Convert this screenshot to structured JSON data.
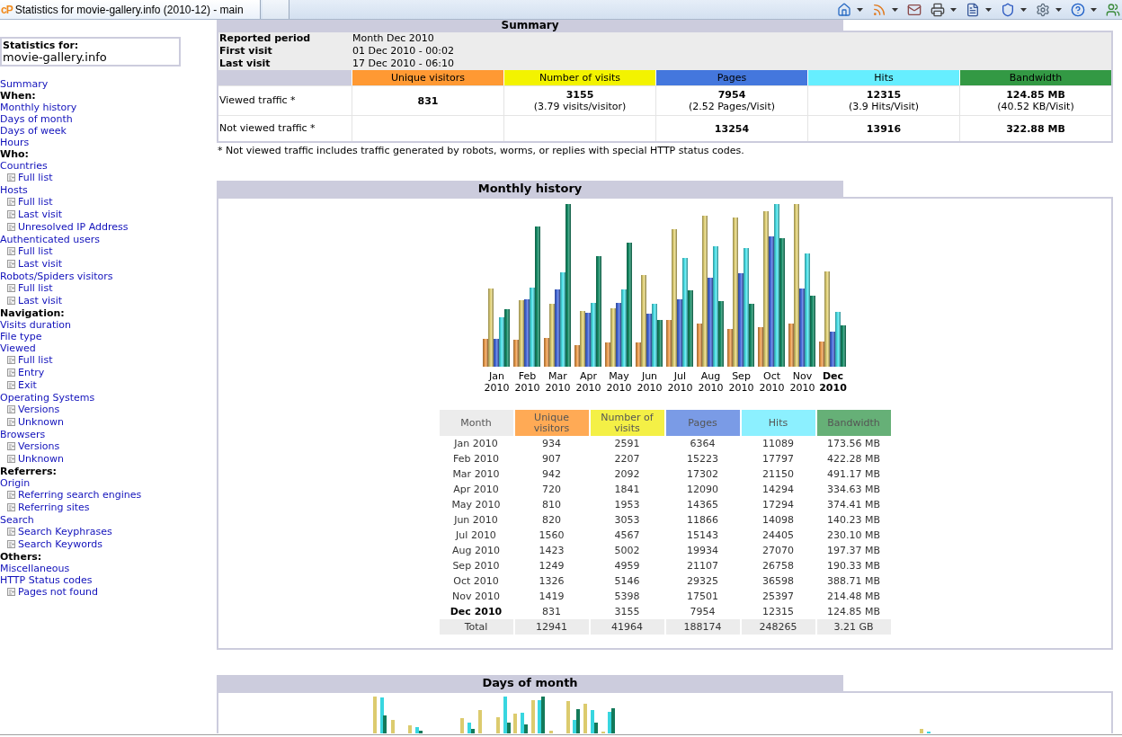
{
  "browser": {
    "tab_logo": "cP",
    "tab_title": "Statistics for movie-gallery.info (2010-12) - main"
  },
  "sidebar": {
    "label": "Statistics for:",
    "site": "movie-gallery.info",
    "entries": [
      {
        "kind": "link",
        "label": "Summary"
      },
      {
        "kind": "heading",
        "label": "When:"
      },
      {
        "kind": "link",
        "label": "Monthly history"
      },
      {
        "kind": "link",
        "label": "Days of month"
      },
      {
        "kind": "link",
        "label": "Days of week"
      },
      {
        "kind": "link",
        "label": "Hours"
      },
      {
        "kind": "heading",
        "label": "Who:"
      },
      {
        "kind": "link",
        "label": "Countries",
        "children": [
          {
            "label": "Full list"
          }
        ]
      },
      {
        "kind": "link",
        "label": "Hosts",
        "children": [
          {
            "label": "Full list"
          },
          {
            "label": "Last visit"
          },
          {
            "label": "Unresolved IP Address"
          }
        ]
      },
      {
        "kind": "link",
        "label": "Authenticated users",
        "children": [
          {
            "label": "Full list"
          },
          {
            "label": "Last visit"
          }
        ]
      },
      {
        "kind": "link",
        "label": "Robots/Spiders visitors",
        "children": [
          {
            "label": "Full list"
          },
          {
            "label": "Last visit"
          }
        ]
      },
      {
        "kind": "heading",
        "label": "Navigation:"
      },
      {
        "kind": "link",
        "label": "Visits duration"
      },
      {
        "kind": "link",
        "label": "File type"
      },
      {
        "kind": "link",
        "label": "Viewed",
        "children": [
          {
            "label": "Full list"
          },
          {
            "label": "Entry"
          },
          {
            "label": "Exit"
          }
        ]
      },
      {
        "kind": "link",
        "label": "Operating Systems",
        "children": [
          {
            "label": "Versions"
          },
          {
            "label": "Unknown"
          }
        ]
      },
      {
        "kind": "link",
        "label": "Browsers",
        "children": [
          {
            "label": "Versions"
          },
          {
            "label": "Unknown"
          }
        ]
      },
      {
        "kind": "heading",
        "label": "Referrers:"
      },
      {
        "kind": "link",
        "label": "Origin",
        "children": [
          {
            "label": "Referring search engines"
          },
          {
            "label": "Referring sites"
          }
        ]
      },
      {
        "kind": "link",
        "label": "Search",
        "children": [
          {
            "label": "Search Keyphrases"
          },
          {
            "label": "Search Keywords"
          }
        ]
      },
      {
        "kind": "heading",
        "label": "Others:"
      },
      {
        "kind": "link",
        "label": "Miscellaneous"
      },
      {
        "kind": "link",
        "label": "HTTP Status codes",
        "children": [
          {
            "label": "Pages not found"
          }
        ]
      }
    ]
  },
  "summary": {
    "title": "Summary",
    "period_rows": [
      {
        "label": "Reported period",
        "value": "Month Dec 2010"
      },
      {
        "label": "First visit",
        "value": "01 Dec 2010 - 00:02"
      },
      {
        "label": "Last visit",
        "value": "17 Dec 2010 - 06:10"
      }
    ],
    "columns": [
      {
        "label": "Unique visitors",
        "color": "#ff9933"
      },
      {
        "label": "Number of visits",
        "color": "#f3f300"
      },
      {
        "label": "Pages",
        "color": "#4477dd"
      },
      {
        "label": "Hits",
        "color": "#66eeff"
      },
      {
        "label": "Bandwidth",
        "color": "#339944"
      }
    ],
    "rows": [
      {
        "label": "Viewed traffic *",
        "cells": [
          {
            "value": "831"
          },
          {
            "value": "3155",
            "note": "(3.79 visits/visitor)"
          },
          {
            "value": "7954",
            "note": "(2.52 Pages/Visit)"
          },
          {
            "value": "12315",
            "note": "(3.9 Hits/Visit)"
          },
          {
            "value": "124.85 MB",
            "note": "(40.52 KB/Visit)"
          }
        ]
      },
      {
        "label": "Not viewed traffic *",
        "cells": [
          null,
          null,
          {
            "value": "13254"
          },
          {
            "value": "13916"
          },
          {
            "value": "322.88 MB"
          }
        ]
      }
    ],
    "footnote": "* Not viewed traffic includes traffic generated by robots, worms, or replies with special HTTP status codes."
  },
  "monthly_history": {
    "title": "Monthly history",
    "chart": {
      "labels": [
        "Jan 2010",
        "Feb 2010",
        "Mar 2010",
        "Apr 2010",
        "May 2010",
        "Jun 2010",
        "Jul 2010",
        "Aug 2010",
        "Sep 2010",
        "Oct 2010",
        "Nov 2010",
        "Dec 2010"
      ]
    },
    "table": {
      "columns": [
        {
          "label": "Month"
        },
        {
          "label": "Unique visitors",
          "color": "#ffaa55"
        },
        {
          "label": "Number of visits",
          "color": "#f4f046"
        },
        {
          "label": "Pages",
          "color": "#7a9be6"
        },
        {
          "label": "Hits",
          "color": "#8cf0ff"
        },
        {
          "label": "Bandwidth",
          "color": "#66b077"
        }
      ],
      "rows": [
        {
          "current": false,
          "cells": [
            "Jan 2010",
            "934",
            "2591",
            "6364",
            "11089",
            "173.56 MB"
          ]
        },
        {
          "current": false,
          "cells": [
            "Feb 2010",
            "907",
            "2207",
            "15223",
            "17797",
            "422.28 MB"
          ]
        },
        {
          "current": false,
          "cells": [
            "Mar 2010",
            "942",
            "2092",
            "17302",
            "21150",
            "491.17 MB"
          ]
        },
        {
          "current": false,
          "cells": [
            "Apr 2010",
            "720",
            "1841",
            "12090",
            "14294",
            "334.63 MB"
          ]
        },
        {
          "current": false,
          "cells": [
            "May 2010",
            "810",
            "1953",
            "14365",
            "17294",
            "374.41 MB"
          ]
        },
        {
          "current": false,
          "cells": [
            "Jun 2010",
            "820",
            "3053",
            "11866",
            "14098",
            "140.23 MB"
          ]
        },
        {
          "current": false,
          "cells": [
            "Jul 2010",
            "1560",
            "4567",
            "15143",
            "24405",
            "230.10 MB"
          ]
        },
        {
          "current": false,
          "cells": [
            "Aug 2010",
            "1423",
            "5002",
            "19934",
            "27070",
            "197.37 MB"
          ]
        },
        {
          "current": false,
          "cells": [
            "Sep 2010",
            "1249",
            "4959",
            "21107",
            "26758",
            "190.33 MB"
          ]
        },
        {
          "current": false,
          "cells": [
            "Oct 2010",
            "1326",
            "5146",
            "29325",
            "36598",
            "388.71 MB"
          ]
        },
        {
          "current": false,
          "cells": [
            "Nov 2010",
            "1419",
            "5398",
            "17501",
            "25397",
            "214.48 MB"
          ]
        },
        {
          "current": true,
          "cells": [
            "Dec 2010",
            "831",
            "3155",
            "7954",
            "12315",
            "124.85 MB"
          ]
        }
      ],
      "total": {
        "cells": [
          "Total",
          "12941",
          "41964",
          "188174",
          "248265",
          "3.21 GB"
        ]
      }
    }
  },
  "days_of_month": {
    "title": "Days of month"
  }
}
